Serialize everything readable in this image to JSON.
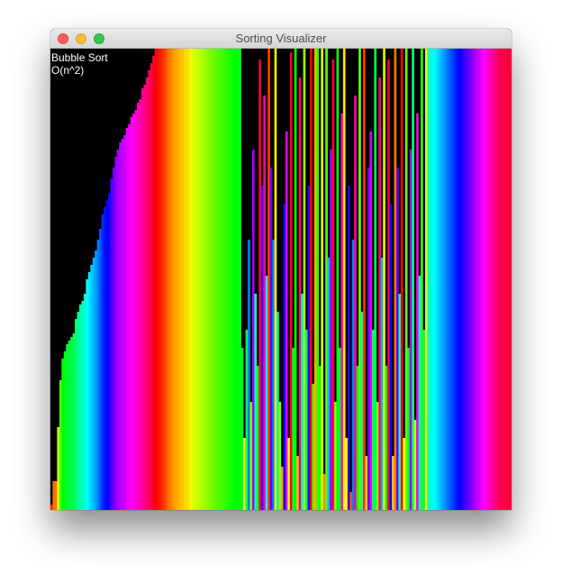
{
  "window": {
    "title": "Sorting Visualizer",
    "controls": [
      "close",
      "minimize",
      "zoom"
    ]
  },
  "overlay": {
    "algorithm": "Bubble Sort",
    "complexity": "O(n^2)"
  },
  "visualization": {
    "type": "bar",
    "bar_count": 256,
    "value_max": 256,
    "sorted_from_index": 172,
    "color_scheme": "hue-by-value",
    "values": [
      3,
      16,
      16,
      46,
      72,
      84,
      88,
      92,
      94,
      96,
      98,
      106,
      110,
      114,
      116,
      120,
      128,
      132,
      136,
      140,
      144,
      150,
      156,
      164,
      168,
      172,
      176,
      184,
      190,
      196,
      200,
      204,
      206,
      208,
      212,
      214,
      218,
      220,
      222,
      226,
      228,
      234,
      236,
      240,
      244,
      248,
      252,
      258,
      262,
      264,
      268,
      270,
      276,
      280,
      282,
      286,
      288,
      290,
      292,
      294,
      296,
      298,
      300,
      306,
      310,
      312,
      314,
      316,
      318,
      320,
      322,
      324,
      326,
      328,
      330,
      332,
      334,
      336,
      338,
      340,
      342,
      344,
      346,
      348,
      350,
      352,
      90,
      40,
      100,
      150,
      60,
      200,
      120,
      80,
      250,
      180,
      230,
      130,
      270,
      190,
      150,
      300,
      110,
      60,
      24,
      170,
      210,
      40,
      254,
      90,
      350,
      30,
      240,
      120,
      320,
      100,
      180,
      260,
      70,
      290,
      340,
      80,
      310,
      20,
      330,
      140,
      200,
      250,
      60,
      350,
      90,
      220,
      300,
      40,
      180,
      10,
      150,
      230,
      80,
      330,
      110,
      270,
      30,
      190,
      210,
      100,
      360,
      60,
      240,
      140,
      310,
      80,
      250,
      170,
      30,
      280,
      190,
      120,
      260,
      40,
      330,
      90,
      200,
      370,
      50,
      220,
      130,
      340,
      100,
      300,
      380,
      384,
      388,
      392,
      396,
      400,
      404,
      408,
      412,
      416,
      420,
      424,
      428,
      432,
      436,
      440,
      444,
      448,
      452,
      456,
      460,
      464,
      468,
      472,
      476,
      480,
      484,
      488,
      492,
      496,
      500,
      504,
      508,
      510,
      511,
      512,
      512,
      512
    ]
  }
}
